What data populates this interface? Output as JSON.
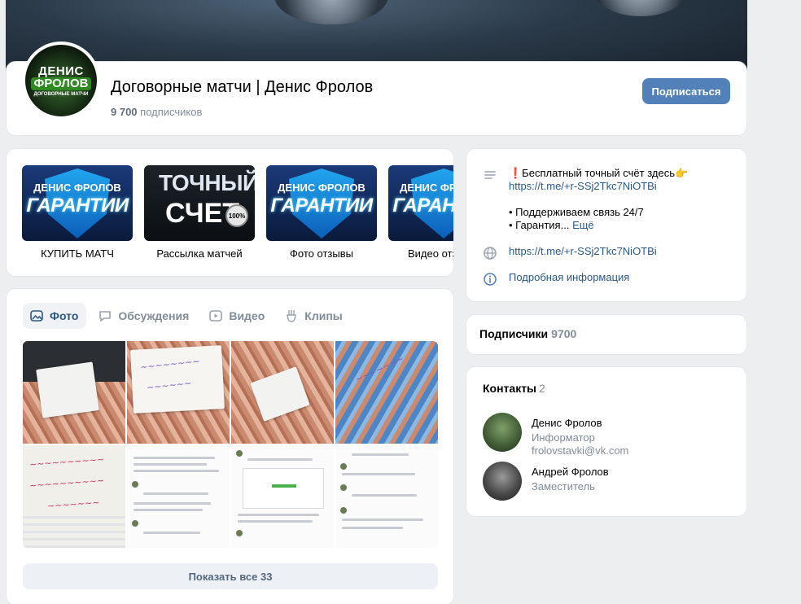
{
  "group": {
    "title": "Договорные матчи | Денис Фролов",
    "subscribers_count": "9 700",
    "subscribers_label": "подписчиков",
    "subscribe_label": "Подписаться",
    "avatar_text": [
      "ДЕНИС",
      "ФРОЛОВ",
      "ДОГОВОРНЫЕ МАТЧИ"
    ]
  },
  "products": [
    {
      "label": "КУПИТЬ МАТЧ",
      "thumb": [
        "ДЕНИС ФРОЛОВ",
        "ГАРАНТИИ"
      ]
    },
    {
      "label": "Рассылка матчей",
      "thumb": [
        "ТОЧНЫЙ",
        "СЧЕТ",
        "100%"
      ]
    },
    {
      "label": "Фото отзывы",
      "thumb": [
        "ДЕНИС ФРОЛОВ",
        "ГАРАНТИИ"
      ]
    },
    {
      "label": "Видео отзывы",
      "thumb": [
        "ДЕНИС ФРОЛОВ",
        "ГАРАНТИИ"
      ]
    }
  ],
  "wall": {
    "tabs": [
      {
        "label": "Фото",
        "icon": "photo-icon",
        "active": true
      },
      {
        "label": "Обсуждения",
        "icon": "discussion-icon",
        "active": false
      },
      {
        "label": "Видео",
        "icon": "video-icon",
        "active": false
      },
      {
        "label": "Клипы",
        "icon": "clips-icon",
        "active": false
      }
    ],
    "show_all_label": "Показать все 33"
  },
  "info": {
    "description_line1": "❗Бесплатный точный счёт здесь👉",
    "description_link": "https://t.me/+r-SSj2Tkc7NiOTBi",
    "description_line2": "• Поддерживаем связь 24/7",
    "description_line3": "• Гарантия...",
    "more_label": "Ещё",
    "website": "https://t.me/+r-SSj2Tkc7NiOTBi",
    "details_label": "Подробная информация"
  },
  "subscribers_block": {
    "title": "Подписчики",
    "count": "9700"
  },
  "contacts": {
    "title": "Контакты",
    "count": "2",
    "items": [
      {
        "name": "Денис Фролов",
        "role": "Информатор",
        "email": "frolovstavki@vk.com"
      },
      {
        "name": "Андрей Фролов",
        "role": "Заместитель"
      }
    ]
  },
  "colors": {
    "accent": "#5181b8",
    "link": "#2a5885",
    "muted": "#818c99",
    "background": "#edeef0"
  }
}
